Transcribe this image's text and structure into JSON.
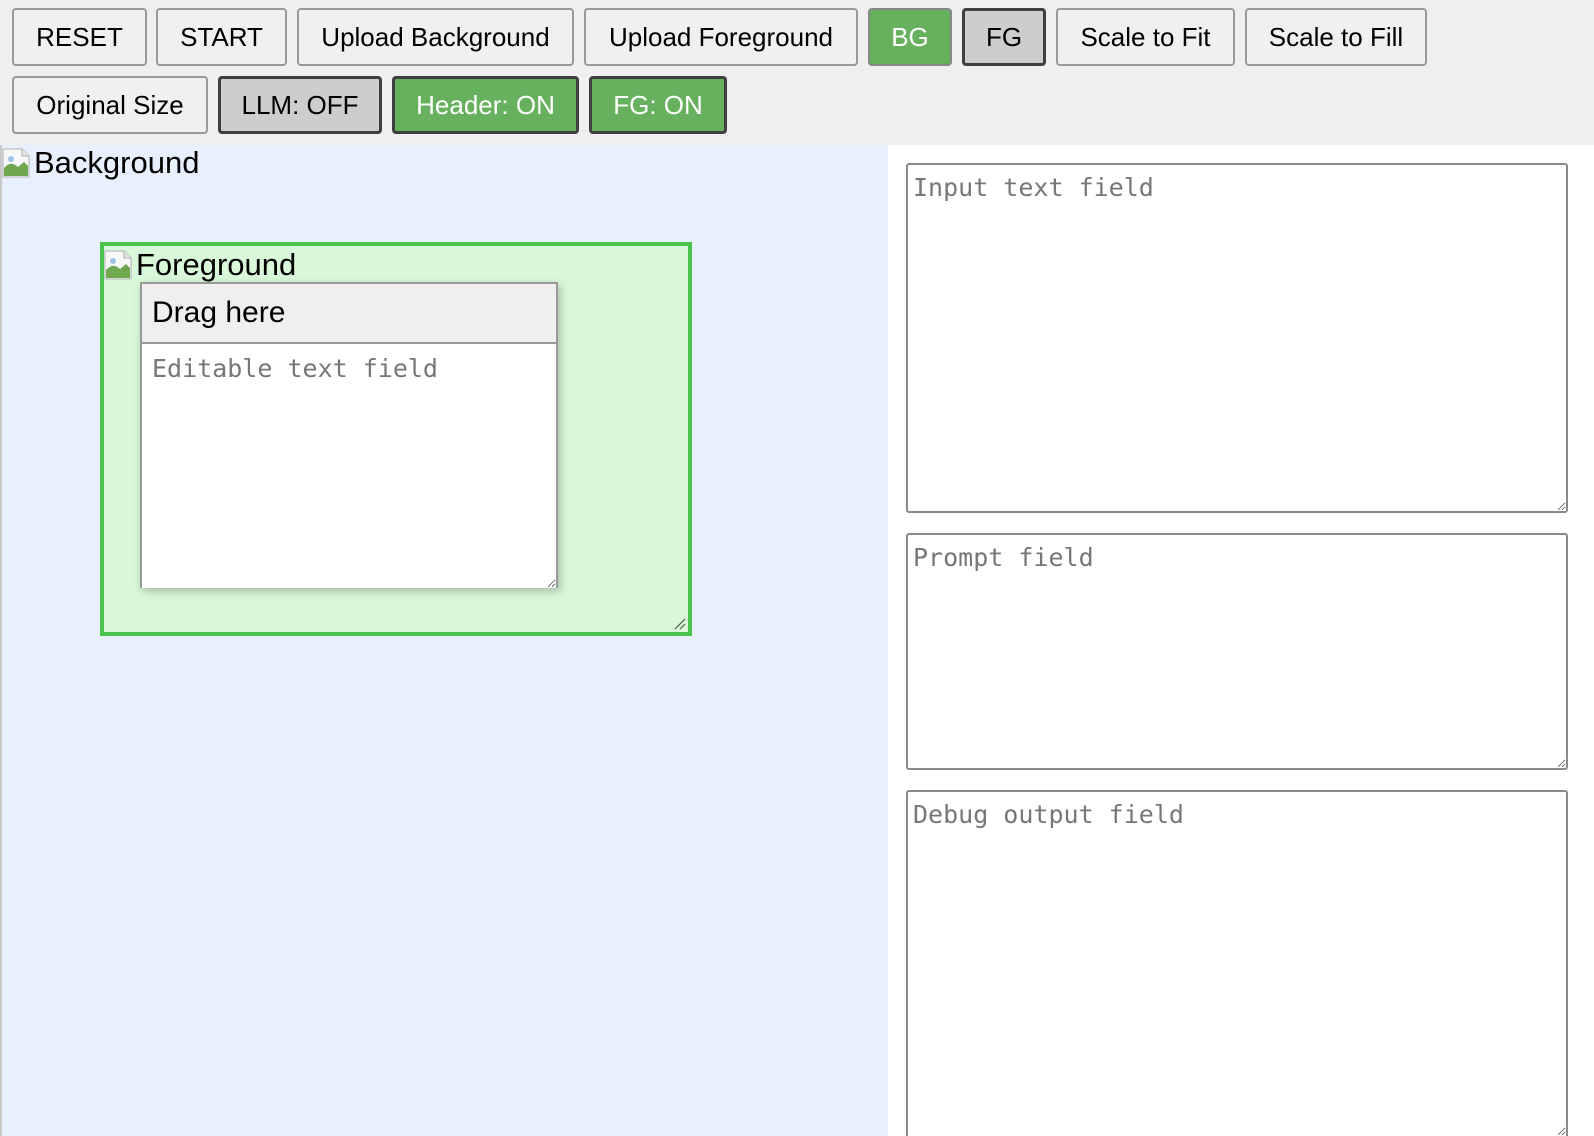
{
  "toolbar": {
    "row1": [
      {
        "id": "reset",
        "label": "RESET"
      },
      {
        "id": "start",
        "label": "START"
      },
      {
        "id": "upload-bg",
        "label": "Upload Background"
      },
      {
        "id": "upload-fg",
        "label": "Upload Foreground"
      },
      {
        "id": "bg",
        "label": "BG",
        "state": "active"
      },
      {
        "id": "fg",
        "label": "FG",
        "state": "inactive"
      },
      {
        "id": "scale-fit",
        "label": "Scale to Fit"
      },
      {
        "id": "scale-fill",
        "label": "Scale to Fill"
      }
    ],
    "row2": [
      {
        "id": "original-size",
        "label": "Original Size"
      },
      {
        "id": "llm-toggle",
        "label": "LLM: OFF",
        "state": "off"
      },
      {
        "id": "header-toggle",
        "label": "Header: ON",
        "state": "on"
      },
      {
        "id": "fg-toggle",
        "label": "FG: ON",
        "state": "on"
      }
    ]
  },
  "canvas": {
    "background_alt": "Background",
    "foreground_alt": "Foreground",
    "drag_header": "Drag here",
    "editable_placeholder": "Editable text field",
    "editable_value": ""
  },
  "side_fields": {
    "input_placeholder": "Input text field",
    "input_value": "",
    "prompt_placeholder": "Prompt field",
    "prompt_value": "",
    "debug_placeholder": "Debug output field",
    "debug_value": ""
  },
  "colors": {
    "active_green": "#66b05e",
    "toggle_grey": "#cdcdcd",
    "canvas_bg": "#e7f0fc",
    "fg_box_fill": "#d9f8d9",
    "fg_box_border": "#4bc24b"
  },
  "icons": {
    "broken_image": "broken-image-icon",
    "resize_grip": "resize-grip-icon"
  }
}
